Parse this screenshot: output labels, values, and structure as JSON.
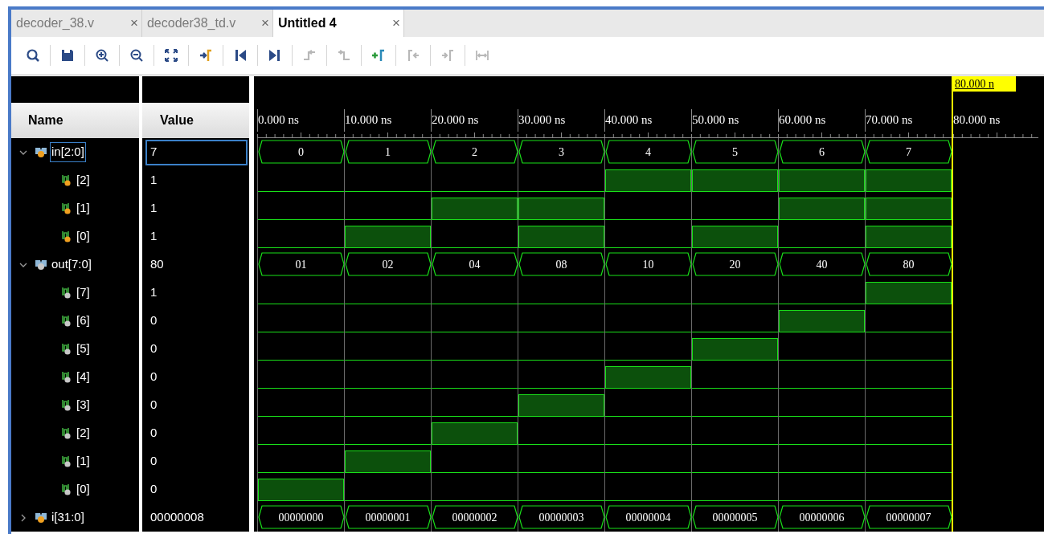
{
  "tabs": [
    {
      "label": "decoder_38.v",
      "selected": false,
      "close": "×"
    },
    {
      "label": "decoder38_td.v",
      "selected": false,
      "close": "×"
    },
    {
      "label": "Untitled 4",
      "selected": true,
      "close": "×"
    }
  ],
  "toolbar": [
    {
      "kind": "search",
      "disabled": false
    },
    {
      "kind": "save",
      "disabled": false
    },
    {
      "kind": "zoomin",
      "disabled": false
    },
    {
      "kind": "zoomout",
      "disabled": false
    },
    {
      "kind": "fit",
      "disabled": false
    },
    {
      "kind": "cursor",
      "disabled": false
    },
    {
      "kind": "start",
      "disabled": false
    },
    {
      "kind": "end",
      "disabled": false
    },
    {
      "kind": "prevedge",
      "disabled": true
    },
    {
      "kind": "nextedge",
      "disabled": true
    },
    {
      "kind": "marker",
      "disabled": false
    },
    {
      "kind": "prevmarker",
      "disabled": true
    },
    {
      "kind": "nextmarker",
      "disabled": true
    },
    {
      "kind": "swap",
      "disabled": true
    }
  ],
  "columns": {
    "name": "Name",
    "value": "Value"
  },
  "cursor": {
    "label": "80.000 n"
  },
  "time_labels": [
    "0.000 ns",
    "10.000 ns",
    "20.000 ns",
    "30.000 ns",
    "40.000 ns",
    "50.000 ns",
    "60.000 ns",
    "70.000 ns",
    "80.000 ns"
  ],
  "signals": [
    {
      "kind": "bus",
      "name": "in[2:0]",
      "value": "7",
      "input": true,
      "selected": true,
      "expanded": true,
      "segments": [
        "0",
        "1",
        "2",
        "3",
        "4",
        "5",
        "6",
        "7"
      ],
      "children": [
        {
          "kind": "bit",
          "name": "[2]",
          "value": "1",
          "input": true,
          "selected": false,
          "high": [
            false,
            false,
            false,
            false,
            true,
            true,
            true,
            true
          ]
        },
        {
          "kind": "bit",
          "name": "[1]",
          "value": "1",
          "input": true,
          "selected": false,
          "high": [
            false,
            false,
            true,
            true,
            false,
            false,
            true,
            true
          ]
        },
        {
          "kind": "bit",
          "name": "[0]",
          "value": "1",
          "input": true,
          "selected": false,
          "high": [
            false,
            true,
            false,
            true,
            false,
            true,
            false,
            true
          ]
        }
      ]
    },
    {
      "kind": "bus",
      "name": "out[7:0]",
      "value": "80",
      "input": false,
      "selected": false,
      "expanded": true,
      "segments": [
        "01",
        "02",
        "04",
        "08",
        "10",
        "20",
        "40",
        "80"
      ],
      "children": [
        {
          "kind": "bit",
          "name": "[7]",
          "value": "1",
          "input": false,
          "selected": false,
          "high": [
            false,
            false,
            false,
            false,
            false,
            false,
            false,
            true
          ]
        },
        {
          "kind": "bit",
          "name": "[6]",
          "value": "0",
          "input": false,
          "selected": false,
          "high": [
            false,
            false,
            false,
            false,
            false,
            false,
            true,
            false
          ]
        },
        {
          "kind": "bit",
          "name": "[5]",
          "value": "0",
          "input": false,
          "selected": false,
          "high": [
            false,
            false,
            false,
            false,
            false,
            true,
            false,
            false
          ]
        },
        {
          "kind": "bit",
          "name": "[4]",
          "value": "0",
          "input": false,
          "selected": false,
          "high": [
            false,
            false,
            false,
            false,
            true,
            false,
            false,
            false
          ]
        },
        {
          "kind": "bit",
          "name": "[3]",
          "value": "0",
          "input": false,
          "selected": false,
          "high": [
            false,
            false,
            false,
            true,
            false,
            false,
            false,
            false
          ]
        },
        {
          "kind": "bit",
          "name": "[2]",
          "value": "0",
          "input": false,
          "selected": false,
          "high": [
            false,
            false,
            true,
            false,
            false,
            false,
            false,
            false
          ]
        },
        {
          "kind": "bit",
          "name": "[1]",
          "value": "0",
          "input": false,
          "selected": false,
          "high": [
            false,
            true,
            false,
            false,
            false,
            false,
            false,
            false
          ]
        },
        {
          "kind": "bit",
          "name": "[0]",
          "value": "0",
          "input": false,
          "selected": false,
          "high": [
            true,
            false,
            false,
            false,
            false,
            false,
            false,
            false
          ]
        }
      ]
    },
    {
      "kind": "bus",
      "name": "i[31:0]",
      "value": "00000008",
      "input": true,
      "selected": false,
      "expanded": false,
      "segments": [
        "00000000",
        "00000001",
        "00000002",
        "00000003",
        "00000004",
        "00000005",
        "00000006",
        "00000007"
      ]
    }
  ]
}
